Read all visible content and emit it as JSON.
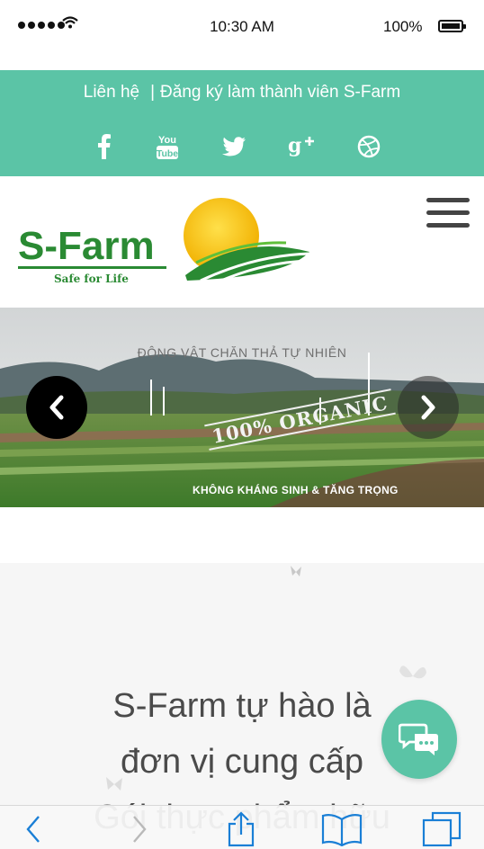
{
  "status_bar": {
    "time": "10:30 AM",
    "battery": "100%",
    "signal_icon": "signal-dots-icon",
    "wifi_icon": "wifi-icon",
    "battery_icon": "battery-icon"
  },
  "top_bar": {
    "background": "#5bc4a6",
    "links": [
      "Liên hệ",
      "Đăng ký làm thành viên S-Farm"
    ],
    "separator": "|",
    "social_icons": [
      "facebook-icon",
      "youtube-icon",
      "twitter-icon",
      "google-plus-icon",
      "dribbble-icon"
    ]
  },
  "header": {
    "logo_text": "S-Farm",
    "logo_tagline": "Safe for Life",
    "menu_icon": "hamburger-menu-icon"
  },
  "hero": {
    "caption_top": "ĐỘNG VẬT CHĂN THẢ TỰ NHIÊN",
    "stamp": "100% ORGANIC",
    "caption_bottom": "KHÔNG KHÁNG SINH & TĂNG TRỌNG",
    "prev_icon": "chevron-left-icon",
    "next_icon": "chevron-right-icon"
  },
  "content": {
    "lines": [
      "S-Farm tự hào là",
      "đơn vị cung cấp",
      "Gói thực phẩm hữu"
    ]
  },
  "chat": {
    "icon": "chat-bubbles-icon",
    "color": "#5bc4a6"
  },
  "toolbar": {
    "icons": [
      "back-icon",
      "forward-icon",
      "share-icon",
      "bookmarks-icon",
      "tabs-icon"
    ],
    "accent": "#1a7fd6"
  }
}
